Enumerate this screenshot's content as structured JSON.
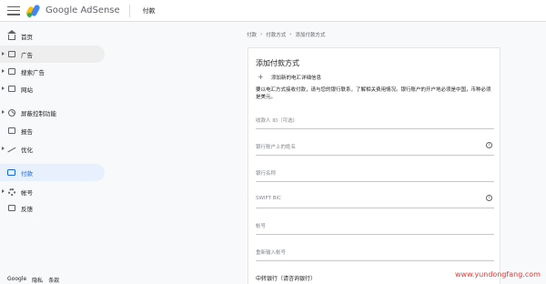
{
  "header": {
    "brand_google": "Google",
    "brand_product": "AdSense",
    "page_title": "付款"
  },
  "sidebar": {
    "items": [
      {
        "label": "首页",
        "icon": "home-icon"
      },
      {
        "label": "广告",
        "icon": "ads-icon"
      },
      {
        "label": "搜索广告",
        "icon": "search-ads-icon"
      },
      {
        "label": "网站",
        "icon": "sites-icon"
      },
      {
        "label": "屏蔽控制功能",
        "icon": "block-icon"
      },
      {
        "label": "报告",
        "icon": "reports-icon"
      },
      {
        "label": "优化",
        "icon": "optimize-icon"
      },
      {
        "label": "付款",
        "icon": "payment-icon"
      },
      {
        "label": "帐号",
        "icon": "account-icon"
      },
      {
        "label": "反馈",
        "icon": "feedback-icon"
      }
    ],
    "footer": {
      "google": "Google",
      "privacy": "隐私",
      "terms": "条款"
    }
  },
  "breadcrumb": [
    "付款",
    "付款方式",
    "添加付款方式"
  ],
  "form": {
    "title": "添加付款方式",
    "add_link": "添加新的电汇详细信息",
    "info": "要以电汇方式接收付款，请与您的银行联系，了解相关费用情况。银行账户的开户地必须是中国，币种必须是美元。",
    "fields": [
      {
        "label": "收款人 ID（可选）",
        "info": false
      },
      {
        "label": "银行账户上的姓名",
        "info": true
      },
      {
        "label": "银行名称",
        "info": false
      },
      {
        "label": "SWIFT BIC",
        "info": true
      },
      {
        "label": "帐号",
        "info": false
      },
      {
        "label": "重新输入帐号",
        "info": false
      },
      {
        "label": "中转银行（请咨询银行）",
        "info": false
      }
    ]
  },
  "watermark": "www.yundongfang.com",
  "colors": {
    "active_bg": "#e8f0fe",
    "active_text": "#1967d2",
    "watermark": "#e53935"
  }
}
